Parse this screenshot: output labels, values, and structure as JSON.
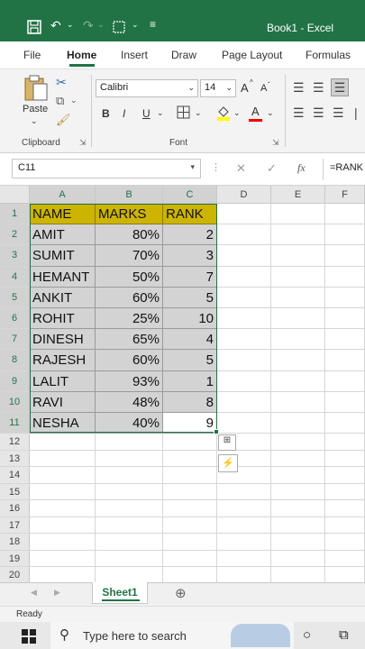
{
  "titlebar": {
    "title": "Book1 - Excel"
  },
  "tabs": [
    "File",
    "Home",
    "Insert",
    "Draw",
    "Page Layout",
    "Formulas"
  ],
  "ribbon": {
    "paste_label": "Paste",
    "clipboard_label": "Clipboard",
    "font_label": "Font",
    "font_name": "Calibri",
    "font_size": "14",
    "bold": "B",
    "italic": "I",
    "underline": "U",
    "grow": "A",
    "shrink": "A",
    "font_color": "A"
  },
  "formula_bar": {
    "name_box": "C11",
    "fx": "fx",
    "formula": "=RANK"
  },
  "columns": [
    "A",
    "B",
    "C",
    "D",
    "E",
    "F"
  ],
  "rows": [
    "1",
    "2",
    "3",
    "4",
    "5",
    "6",
    "7",
    "8",
    "9",
    "10",
    "11",
    "12",
    "13",
    "14",
    "15",
    "16",
    "17",
    "18",
    "19",
    "20"
  ],
  "table": {
    "headers": [
      "NAME",
      "MARKS",
      "RANK"
    ],
    "data": [
      [
        "AMIT",
        "80%",
        "2"
      ],
      [
        "SUMIT",
        "70%",
        "3"
      ],
      [
        "HEMANT",
        "50%",
        "7"
      ],
      [
        "ANKIT",
        "60%",
        "5"
      ],
      [
        "ROHIT",
        "25%",
        "10"
      ],
      [
        "DINESH",
        "65%",
        "4"
      ],
      [
        "RAJESH",
        "60%",
        "5"
      ],
      [
        "LALIT",
        "93%",
        "1"
      ],
      [
        "RAVI",
        "48%",
        "8"
      ],
      [
        "NESHA",
        "40%",
        "9"
      ]
    ]
  },
  "sheet_tab": "Sheet1",
  "status": "Ready",
  "taskbar": {
    "search_placeholder": "Type here to search"
  },
  "colors": {
    "accent": "#217346",
    "header_fill": "#CCB400",
    "selection_fill": "#D3D3D3"
  }
}
